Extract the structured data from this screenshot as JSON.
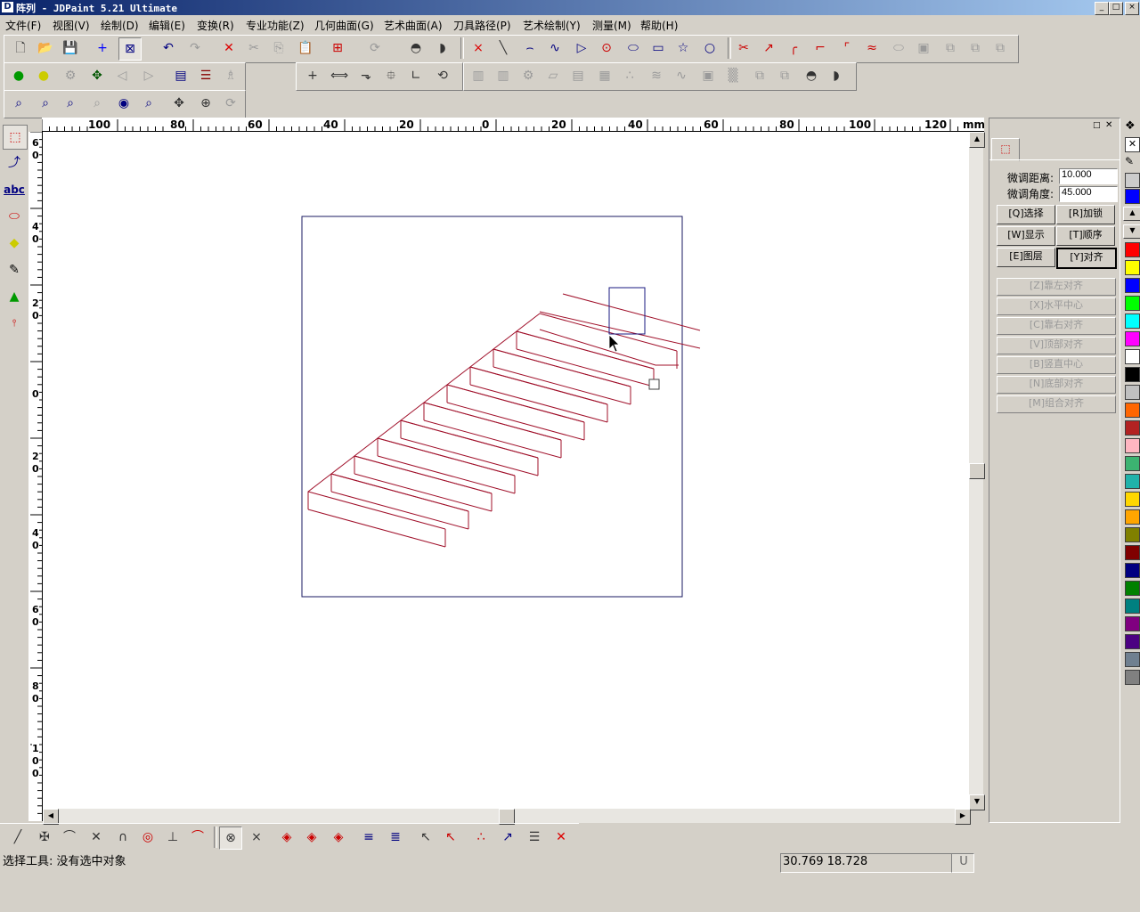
{
  "window": {
    "title": "阵列 - JDPaint 5.21 Ultimate",
    "logo_glyph": "D",
    "controls": [
      "_",
      "□",
      "×"
    ]
  },
  "menu": [
    "文件(F)",
    "视图(V)",
    "绘制(D)",
    "编辑(E)",
    "变换(R)",
    "专业功能(Z)",
    "几何曲面(G)",
    "艺术曲面(A)",
    "刀具路径(P)",
    "艺术绘制(Y)",
    "测量(M)",
    "帮助(H)"
  ],
  "toolbar_icons": {
    "row1": [
      "new-file-icon",
      "open-file-icon",
      "save-icon",
      "snap-cross-icon",
      "select-box-icon",
      "undo-icon",
      "redo-icon",
      "delete-icon",
      "cut-icon",
      "copy-icon",
      "paste-icon",
      "grid-icon",
      "rotate-icon",
      "shield-icon",
      "shield2-icon",
      "point-icon",
      "line-icon",
      "arc-icon",
      "spline-icon",
      "polyline-icon",
      "circle-center-icon",
      "ellipse-icon",
      "rectangle-icon",
      "star-icon",
      "circle-icon",
      "trim-icon",
      "extend-icon",
      "fillet-icon",
      "chamfer-icon",
      "corner-icon",
      "offset-icon",
      "slot-icon",
      "frame-icon",
      "array1-icon",
      "array2-icon",
      "array3-icon"
    ],
    "row2": [
      "green-bulb-icon",
      "yellow-bulb-icon",
      "gear-icon",
      "node-icon",
      "left-arrow-icon",
      "right-arrow-icon",
      "layers-icon",
      "hatch-icon",
      "trophy-icon",
      "plus-icon",
      "dimension-icon",
      "step-icon",
      "measure-icon",
      "angle-icon",
      "rotate-view-icon"
    ],
    "row3": [
      "zoom-window-icon",
      "zoom-in-icon",
      "zoom-out-icon",
      "zoom-extents-icon",
      "eye-icon",
      "zoom-region-icon",
      "pan-icon",
      "zoom-icon",
      "refresh-icon"
    ]
  },
  "rulers": {
    "unit": "mm",
    "h_labels": [
      "100",
      "80",
      "60",
      "40",
      "20",
      "0",
      "20",
      "40",
      "60",
      "80",
      "100",
      "120"
    ],
    "v_labels": [
      "60",
      "40",
      "20",
      "0",
      "20",
      "40",
      "60",
      "80",
      "100"
    ]
  },
  "right_panel": {
    "fine_distance_label": "微调距离:",
    "fine_distance_value": "10.000",
    "fine_angle_label": "微调角度:",
    "fine_angle_value": "45.000",
    "buttons": [
      "[Q]选择",
      "[R]加锁",
      "[W]显示",
      "[T]顺序",
      "[E]图层",
      "[Y]对齐"
    ],
    "align_buttons": [
      "[Z]靠左对齐",
      "[X]水平中心",
      "[C]靠右对齐",
      "[V]顶部对齐",
      "[B]竖直中心",
      "[N]底部对齐",
      "[M]组合对齐"
    ]
  },
  "palette": [
    "#0000ff",
    "#ff0000",
    "#ffff00",
    "#0000ff",
    "#00ff00",
    "#00ffff",
    "#ff00ff",
    "#ffffff",
    "#000000",
    "#c0c0c0",
    "#ff6600",
    "#b22222",
    "#ffb6c1",
    "#3cb371",
    "#20b2aa",
    "#ffd700",
    "#ffa500",
    "#808000",
    "#800000",
    "#000080",
    "#008000",
    "#008080",
    "#800080",
    "#4b0082",
    "#708090",
    "#808080"
  ],
  "colors": {
    "drawing_lines": "#a0102a",
    "frame": "#1a1a60",
    "selection": "#1a1a80"
  },
  "status": {
    "message": "选择工具: 没有选中对象",
    "coords": "30.769 18.728",
    "mode": "U"
  }
}
